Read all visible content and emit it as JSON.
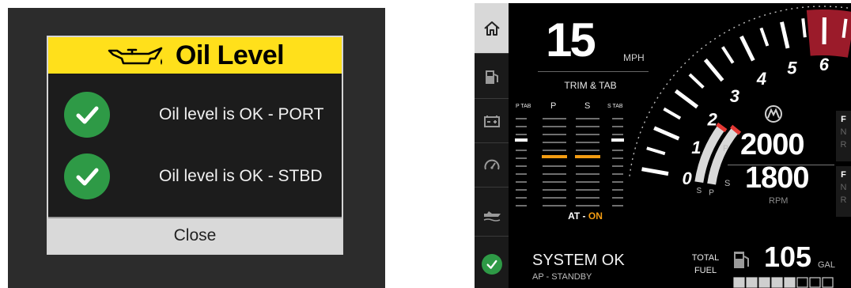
{
  "oil_dialog": {
    "title": "Oil Level",
    "rows": [
      {
        "text": "Oil level is OK - PORT",
        "status": "ok"
      },
      {
        "text": "Oil level is OK - STBD",
        "status": "ok"
      }
    ],
    "close_label": "Close"
  },
  "dashboard": {
    "speed": {
      "value": "15",
      "unit": "MPH"
    },
    "trim": {
      "title": "TRIM & TAB",
      "columns": [
        "P TAB",
        "P",
        "S",
        "S TAB"
      ],
      "autotrim_prefix": "AT - ",
      "autotrim_value": "ON"
    },
    "tach": {
      "scale_labels": [
        "0",
        "1",
        "2",
        "3",
        "4",
        "5",
        "6"
      ],
      "redline_start": 5.6,
      "port_bar_fraction": 0.95,
      "stbd_bar_fraction": 0.85,
      "bar_labels": [
        "P",
        "S"
      ]
    },
    "rpm": {
      "port": "2000",
      "stbd": "1800",
      "port_label": "P",
      "stbd_label": "S",
      "unit": "RPM"
    },
    "gears": [
      {
        "gear": [
          "F",
          "N",
          "R"
        ],
        "active": "F"
      },
      {
        "gear": [
          "F",
          "N",
          "R"
        ],
        "active": "F"
      }
    ],
    "system": {
      "status": "SYSTEM OK",
      "autopilot": "AP - STANDBY"
    },
    "fuel": {
      "label_line1": "TOTAL",
      "label_line2": "FUEL",
      "value": "105",
      "unit": "GAL",
      "segments_filled": 5,
      "segments_total": 8
    },
    "nav": [
      "home-icon",
      "fuel-pump-icon",
      "battery-icon",
      "gauge-icon",
      "boat-icon",
      "check-icon"
    ],
    "colors": {
      "ok_green": "#2e9a46",
      "accent_orange": "#f39c12",
      "redline": "#9b1b2a",
      "header_yellow": "#ffe01b"
    }
  }
}
